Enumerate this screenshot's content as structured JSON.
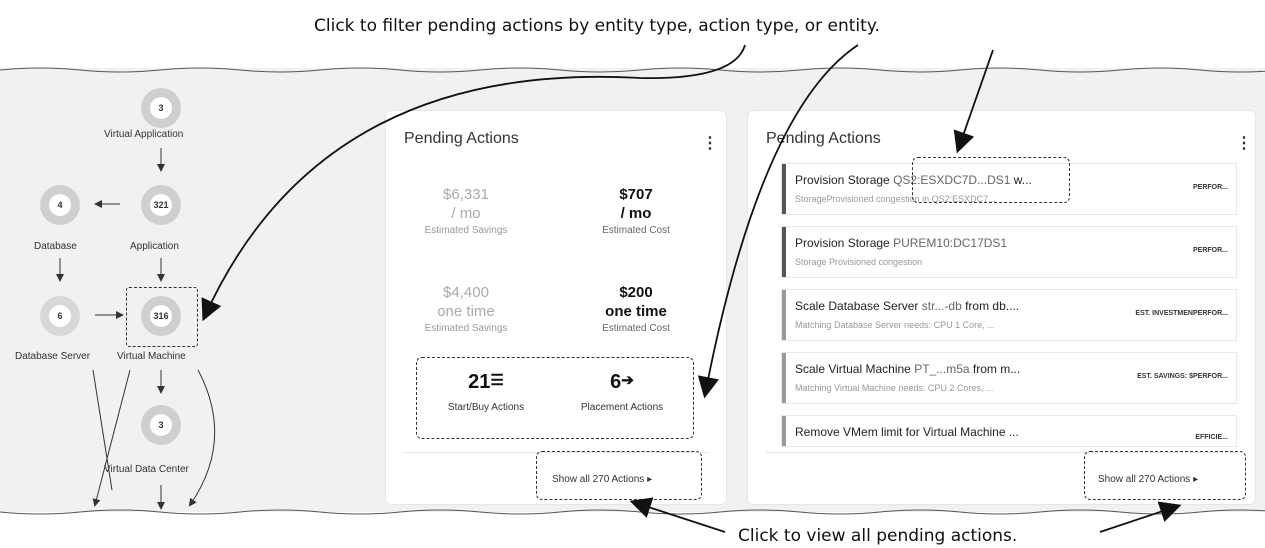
{
  "annotations": {
    "top": "Click to filter pending actions by entity type, action type, or entity.",
    "bottom": "Click to view all pending actions."
  },
  "topology": {
    "nodes": [
      {
        "id": "virtual-application",
        "count": "3",
        "label": "Virtual Application"
      },
      {
        "id": "database",
        "count": "4",
        "label": "Database"
      },
      {
        "id": "application",
        "count": "321",
        "label": "Application"
      },
      {
        "id": "database-server",
        "count": "6",
        "label": "Database Server"
      },
      {
        "id": "virtual-machine",
        "count": "316",
        "label": "Virtual Machine"
      },
      {
        "id": "virtual-data-center",
        "count": "3",
        "label": "Virtual Data Center"
      }
    ]
  },
  "pending_summary": {
    "title": "Pending Actions",
    "monthly": {
      "savings": {
        "value": "$6,331",
        "unit": "/ mo",
        "label": "Estimated Savings"
      },
      "cost": {
        "value": "$707",
        "unit": "/ mo",
        "label": "Estimated Cost"
      }
    },
    "one_time": {
      "savings": {
        "value": "$4,400",
        "unit": "one time",
        "label": "Estimated Savings"
      },
      "cost": {
        "value": "$200",
        "unit": "one time",
        "label": "Estimated Cost"
      }
    },
    "start_buy": {
      "count": "21",
      "label": "Start/Buy Actions",
      "icon": "list-icon"
    },
    "placement": {
      "count": "6",
      "label": "Placement Actions",
      "icon": "arrow-right-icon"
    },
    "show_all": "Show all 270 Actions"
  },
  "pending_list": {
    "title": "Pending Actions",
    "rows": [
      {
        "action": "Provision Storage",
        "entity": "QS2:ESXDC7D...DS1",
        "suffix": " w...",
        "subtitle": "StorageProvisioned congestion in QS2:ESXDC7...",
        "tag": "PERFOR...",
        "bar_color": "#555555"
      },
      {
        "action": "Provision Storage",
        "entity": "PUREM10:DC17DS1",
        "suffix": "",
        "subtitle": "Storage Provisioned congestion",
        "tag": "PERFOR...",
        "bar_color": "#555555"
      },
      {
        "action": "Scale Database Server",
        "entity": "str...-db",
        "suffix": " from db....",
        "subtitle": "Matching Database Server needs: CPU 1 Core, ...",
        "tag": "EST. INVESTMENPERFOR...",
        "bar_color": "#999999"
      },
      {
        "action": "Scale Virtual Machine",
        "entity": "PT_...m5a",
        "suffix": " from m...",
        "subtitle": "Matching Virtual Machine needs: CPU 2 Cores, ...",
        "tag": "EST. SAVINGS: $PERFOR...",
        "bar_color": "#999999"
      },
      {
        "action": "Remove VMem limit for Virtual Machine",
        "entity": "",
        "suffix": " ...",
        "subtitle": "",
        "tag": "EFFICIE...",
        "bar_color": "#999999"
      }
    ],
    "show_all": "Show all 270 Actions"
  },
  "colors": {
    "background": "#f1f1f1",
    "card": "#ffffff",
    "node_ring": "#cfcfcf"
  }
}
